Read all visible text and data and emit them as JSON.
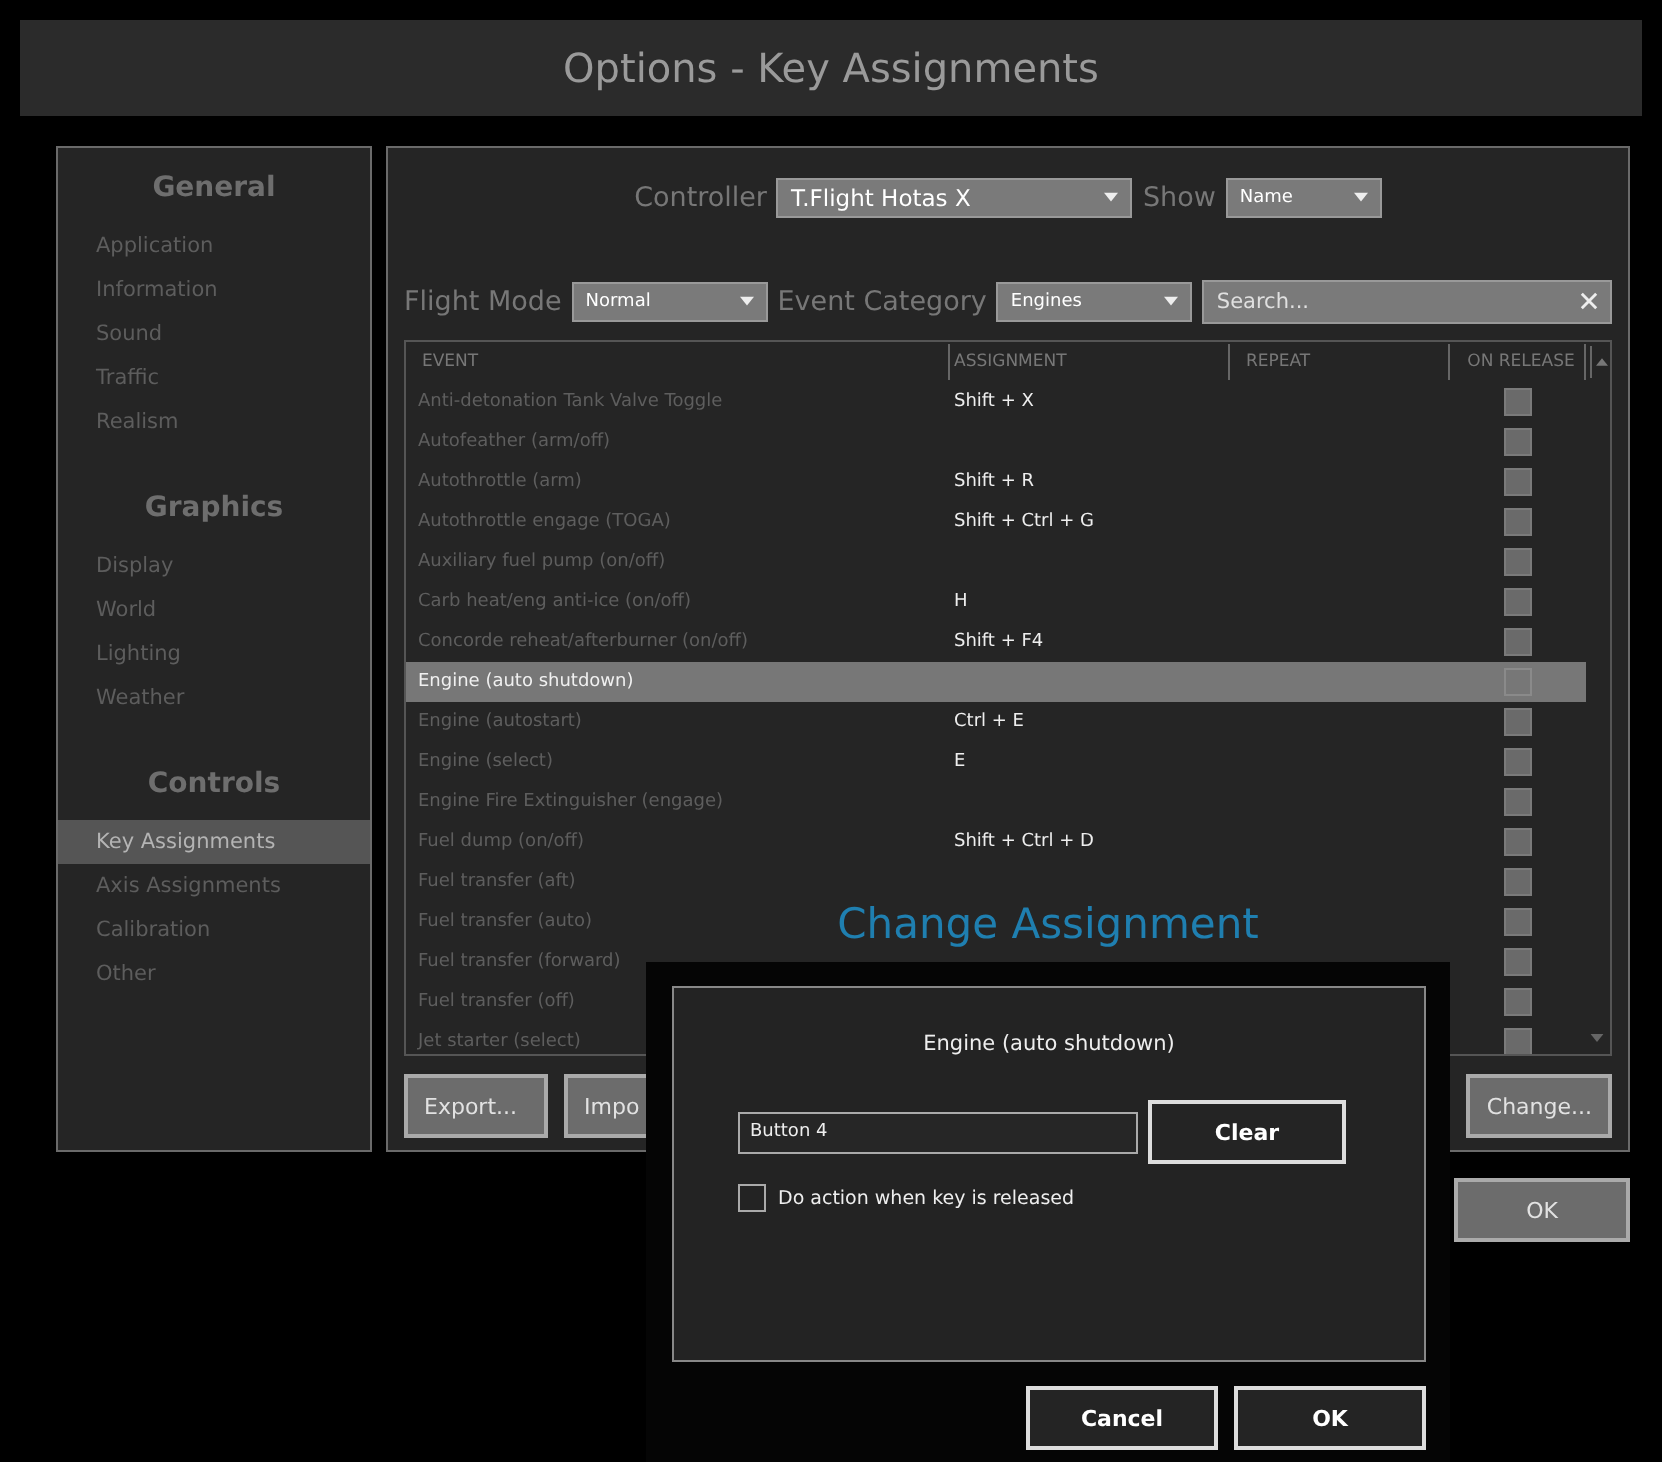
{
  "window": {
    "title": "Options - Key Assignments"
  },
  "sidebar": {
    "groups": [
      {
        "heading": "General",
        "items": [
          {
            "label": "Application",
            "selected": false
          },
          {
            "label": "Information",
            "selected": false
          },
          {
            "label": "Sound",
            "selected": false
          },
          {
            "label": "Traffic",
            "selected": false
          },
          {
            "label": "Realism",
            "selected": false
          }
        ]
      },
      {
        "heading": "Graphics",
        "items": [
          {
            "label": "Display",
            "selected": false
          },
          {
            "label": "World",
            "selected": false
          },
          {
            "label": "Lighting",
            "selected": false
          },
          {
            "label": "Weather",
            "selected": false
          }
        ]
      },
      {
        "heading": "Controls",
        "items": [
          {
            "label": "Key Assignments",
            "selected": true
          },
          {
            "label": "Axis Assignments",
            "selected": false
          },
          {
            "label": "Calibration",
            "selected": false
          },
          {
            "label": "Other",
            "selected": false
          }
        ]
      }
    ]
  },
  "controller": {
    "label": "Controller",
    "value": "T.Flight Hotas X"
  },
  "show": {
    "label": "Show",
    "value": "Name"
  },
  "flight_mode": {
    "label": "Flight Mode",
    "value": "Normal"
  },
  "event_category": {
    "label": "Event Category",
    "value": "Engines"
  },
  "search": {
    "placeholder": "Search..."
  },
  "table": {
    "columns": [
      "EVENT",
      "ASSIGNMENT",
      "REPEAT",
      "ON RELEASE"
    ],
    "rows": [
      {
        "event": "Anti-detonation Tank Valve Toggle",
        "assignment": "Shift + X",
        "on_release": false,
        "selected": false
      },
      {
        "event": "Autofeather (arm/off)",
        "on_release": false,
        "selected": false
      },
      {
        "event": "Autothrottle (arm)",
        "assignment": "Shift + R",
        "on_release": false,
        "selected": false
      },
      {
        "event": "Autothrottle engage (TOGA)",
        "assignment": "Shift + Ctrl + G",
        "on_release": false,
        "selected": false
      },
      {
        "event": "Auxiliary fuel pump (on/off)",
        "on_release": false,
        "selected": false
      },
      {
        "event": "Carb heat/eng anti-ice (on/off)",
        "assignment": "H",
        "on_release": false,
        "selected": false
      },
      {
        "event": "Concorde reheat/afterburner (on/off)",
        "assignment": "Shift + F4",
        "on_release": false,
        "selected": false
      },
      {
        "event": "Engine (auto shutdown)",
        "on_release": false,
        "selected": true
      },
      {
        "event": "Engine (autostart)",
        "assignment": "Ctrl + E",
        "on_release": false,
        "selected": false
      },
      {
        "event": "Engine (select)",
        "assignment": "E",
        "on_release": false,
        "selected": false
      },
      {
        "event": "Engine Fire Extinguisher (engage)",
        "on_release": false,
        "selected": false
      },
      {
        "event": "Fuel dump (on/off)",
        "assignment": "Shift + Ctrl + D",
        "on_release": false,
        "selected": false
      },
      {
        "event": "Fuel transfer (aft)",
        "on_release": false,
        "selected": false
      },
      {
        "event": "Fuel transfer (auto)",
        "on_release": false,
        "selected": false
      },
      {
        "event": "Fuel transfer (forward)",
        "on_release": false,
        "selected": false
      },
      {
        "event": "Fuel transfer (off)",
        "on_release": false,
        "selected": false
      },
      {
        "event": "Jet starter (select)",
        "on_release": false,
        "selected": false
      }
    ]
  },
  "panel_buttons": [
    {
      "label": "Export...",
      "disabled": true
    },
    {
      "label": "Impo",
      "disabled": true
    },
    {
      "label": "Change...",
      "disabled": true
    }
  ],
  "ok_button": {
    "label": "OK",
    "disabled": true
  },
  "dialog": {
    "heading": "Change Assignment",
    "event": "Engine (auto shutdown)",
    "input_value": "Button 4",
    "clear_label": "Clear",
    "release_option": {
      "label": "Do action when key is released",
      "checked": false
    },
    "buttons": [
      "Cancel",
      "OK"
    ]
  }
}
